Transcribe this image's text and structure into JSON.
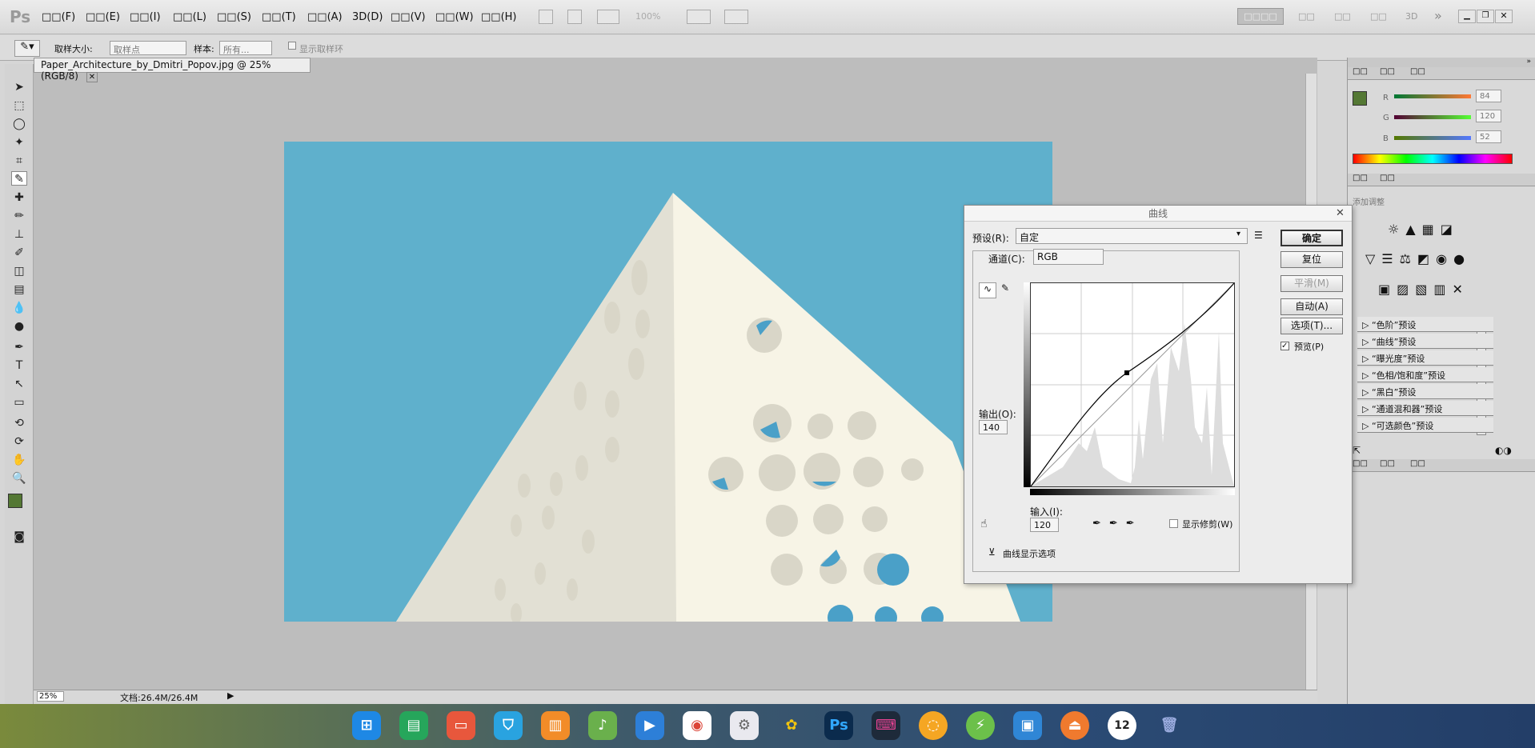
{
  "app": {
    "logo": "Ps"
  },
  "menubar": {
    "items": [
      "□□(F)",
      "□□(E)",
      "□□(I)",
      "□□(L)",
      "□□(S)",
      "□□(T)",
      "□□(A)",
      "3D(D)",
      "□□(V)",
      "□□(W)",
      "□□(H)"
    ],
    "zoom": "100%",
    "workspace": "□□□□",
    "ws_items": [
      "□□",
      "□□",
      "□□",
      "3D"
    ]
  },
  "options": {
    "sample_size_label": "取样大小:",
    "sample_size_value": "取样点",
    "sample_label": "样本:",
    "sample_value": "所有...",
    "ring_label": "显示取样环"
  },
  "document": {
    "tab_title": "Paper_Architecture_by_Dmitri_Popov.jpg @ 25%(RGB/8)",
    "zoom": "25%",
    "doc_size": "文档:26.4M/26.4M"
  },
  "color_panel": {
    "tabs": [
      "□□",
      "□□",
      "□□"
    ],
    "r": "84",
    "g": "120",
    "b": "52",
    "r_label": "R",
    "g_label": "G",
    "b_label": "B",
    "fg_color": "#547834"
  },
  "adjust_panel": {
    "tabs": [
      "□□",
      "□□"
    ],
    "title": "添加调整",
    "presets": [
      "“色阶”预设",
      "“曲线”预设",
      "“曝光度”预设",
      "“色相/饱和度”预设",
      "“黑白”预设",
      "“通道混和器”预设",
      "“可选颜色”预设"
    ],
    "bottom_tabs": [
      "□□",
      "□□",
      "□□"
    ]
  },
  "curves": {
    "title": "曲线",
    "preset_label": "预设(R):",
    "preset_value": "自定",
    "channel_label": "通道(C):",
    "channel_value": "RGB",
    "ok": "确定",
    "reset": "复位",
    "smooth": "平滑(M)",
    "auto": "自动(A)",
    "options": "选项(T)...",
    "preview": "预览(P)",
    "output_label": "输出(O):",
    "output_value": "140",
    "input_label": "输入(I):",
    "input_value": "120",
    "clip_label": "显示修剪(W)",
    "display_options": "曲线显示选项"
  },
  "taskbar": {
    "apps": [
      "launcher",
      "files",
      "slides",
      "store",
      "archive",
      "music",
      "video",
      "chrome",
      "settings",
      "photos",
      "photoshop",
      "capture",
      "circle",
      "power",
      "docs",
      "disc",
      "clock",
      "trash"
    ],
    "clock_text": "12"
  }
}
